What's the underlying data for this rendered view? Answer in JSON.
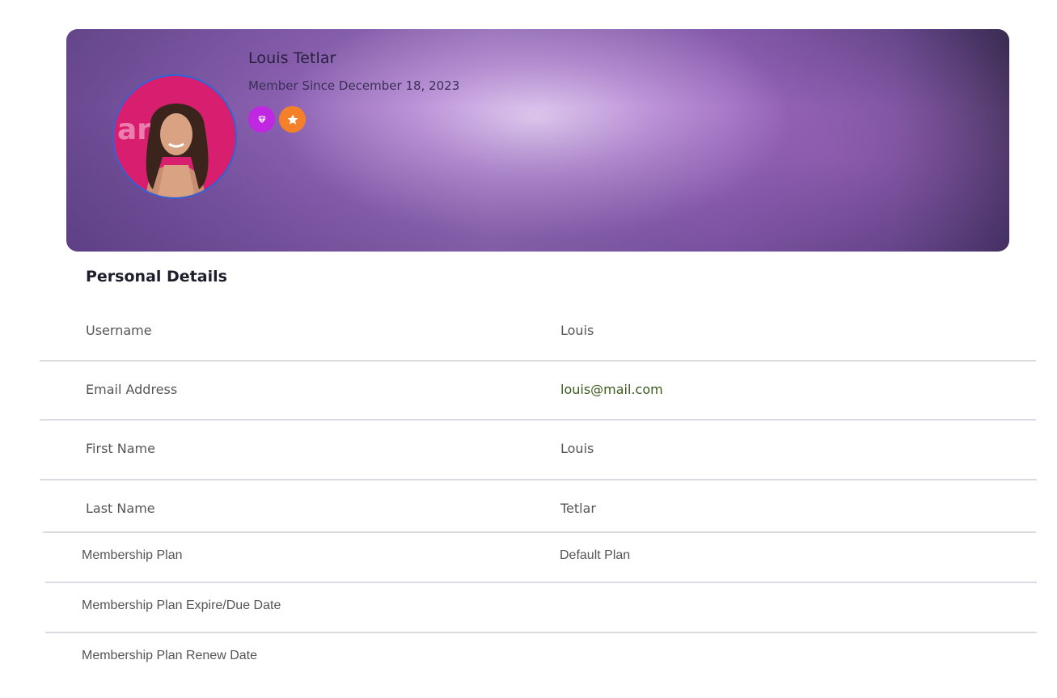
{
  "profile": {
    "name": "Louis Tetlar",
    "member_since": "Member Since December 18, 2023",
    "badges": [
      {
        "icon": "diamond-icon",
        "color": "#c027e0"
      },
      {
        "icon": "star-icon",
        "color": "#f5802a"
      }
    ]
  },
  "section_title": "Personal Details",
  "details": [
    {
      "label": "Username",
      "value": "Louis"
    },
    {
      "label": "Email Address",
      "value": "louis@mail.com"
    },
    {
      "label": "First Name",
      "value": "Louis"
    },
    {
      "label": "Last Name",
      "value": "Tetlar"
    },
    {
      "label": "Membership Plan",
      "value": "Default Plan"
    },
    {
      "label": "Membership Plan Expire/Due Date",
      "value": ""
    },
    {
      "label": "Membership Plan Renew Date",
      "value": ""
    }
  ],
  "colors": {
    "avatar_border": "#2f63d9",
    "email_text": "#3d5a1c",
    "divider": "#d9dce3"
  }
}
